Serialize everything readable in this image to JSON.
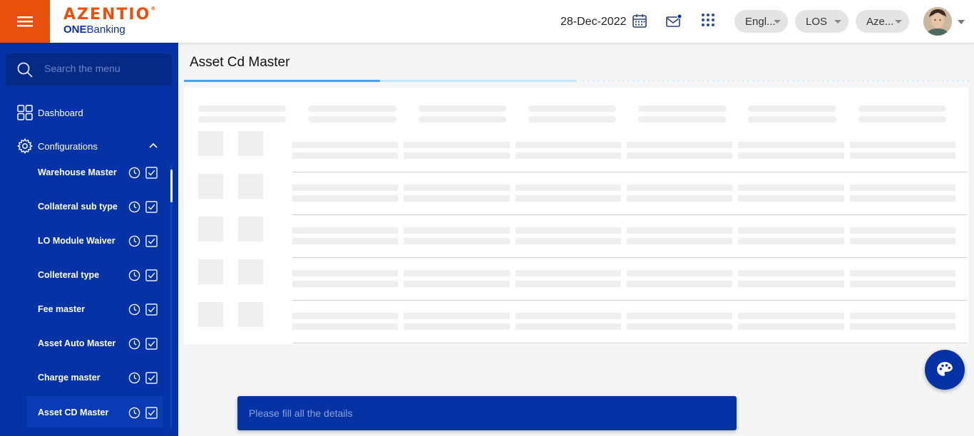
{
  "header": {
    "brand_top": "AZENTIO",
    "brand_bottom_bold": "ONE",
    "brand_bottom_rest": "Banking",
    "date": "28-Dec-2022",
    "language": "Engl...",
    "module": "LOS",
    "entity": "Aze..."
  },
  "sidebar": {
    "search_placeholder": "Search the menu",
    "dashboard": "Dashboard",
    "configurations": "Configurations",
    "items": [
      {
        "label": "Warehouse Master"
      },
      {
        "label": "Collateral sub type"
      },
      {
        "label": "LO Module Waiver"
      },
      {
        "label": "Colleteral type"
      },
      {
        "label": "Fee master"
      },
      {
        "label": "Asset Auto Master"
      },
      {
        "label": "Charge master"
      },
      {
        "label": "Asset CD Master"
      }
    ]
  },
  "main": {
    "title": "Asset Cd Master"
  },
  "toast": {
    "message": "Please fill all the details"
  },
  "colors": {
    "brand_orange": "#e8500e",
    "sidebar_blue": "#0533a6",
    "accent_blue": "#4aa3e6"
  }
}
